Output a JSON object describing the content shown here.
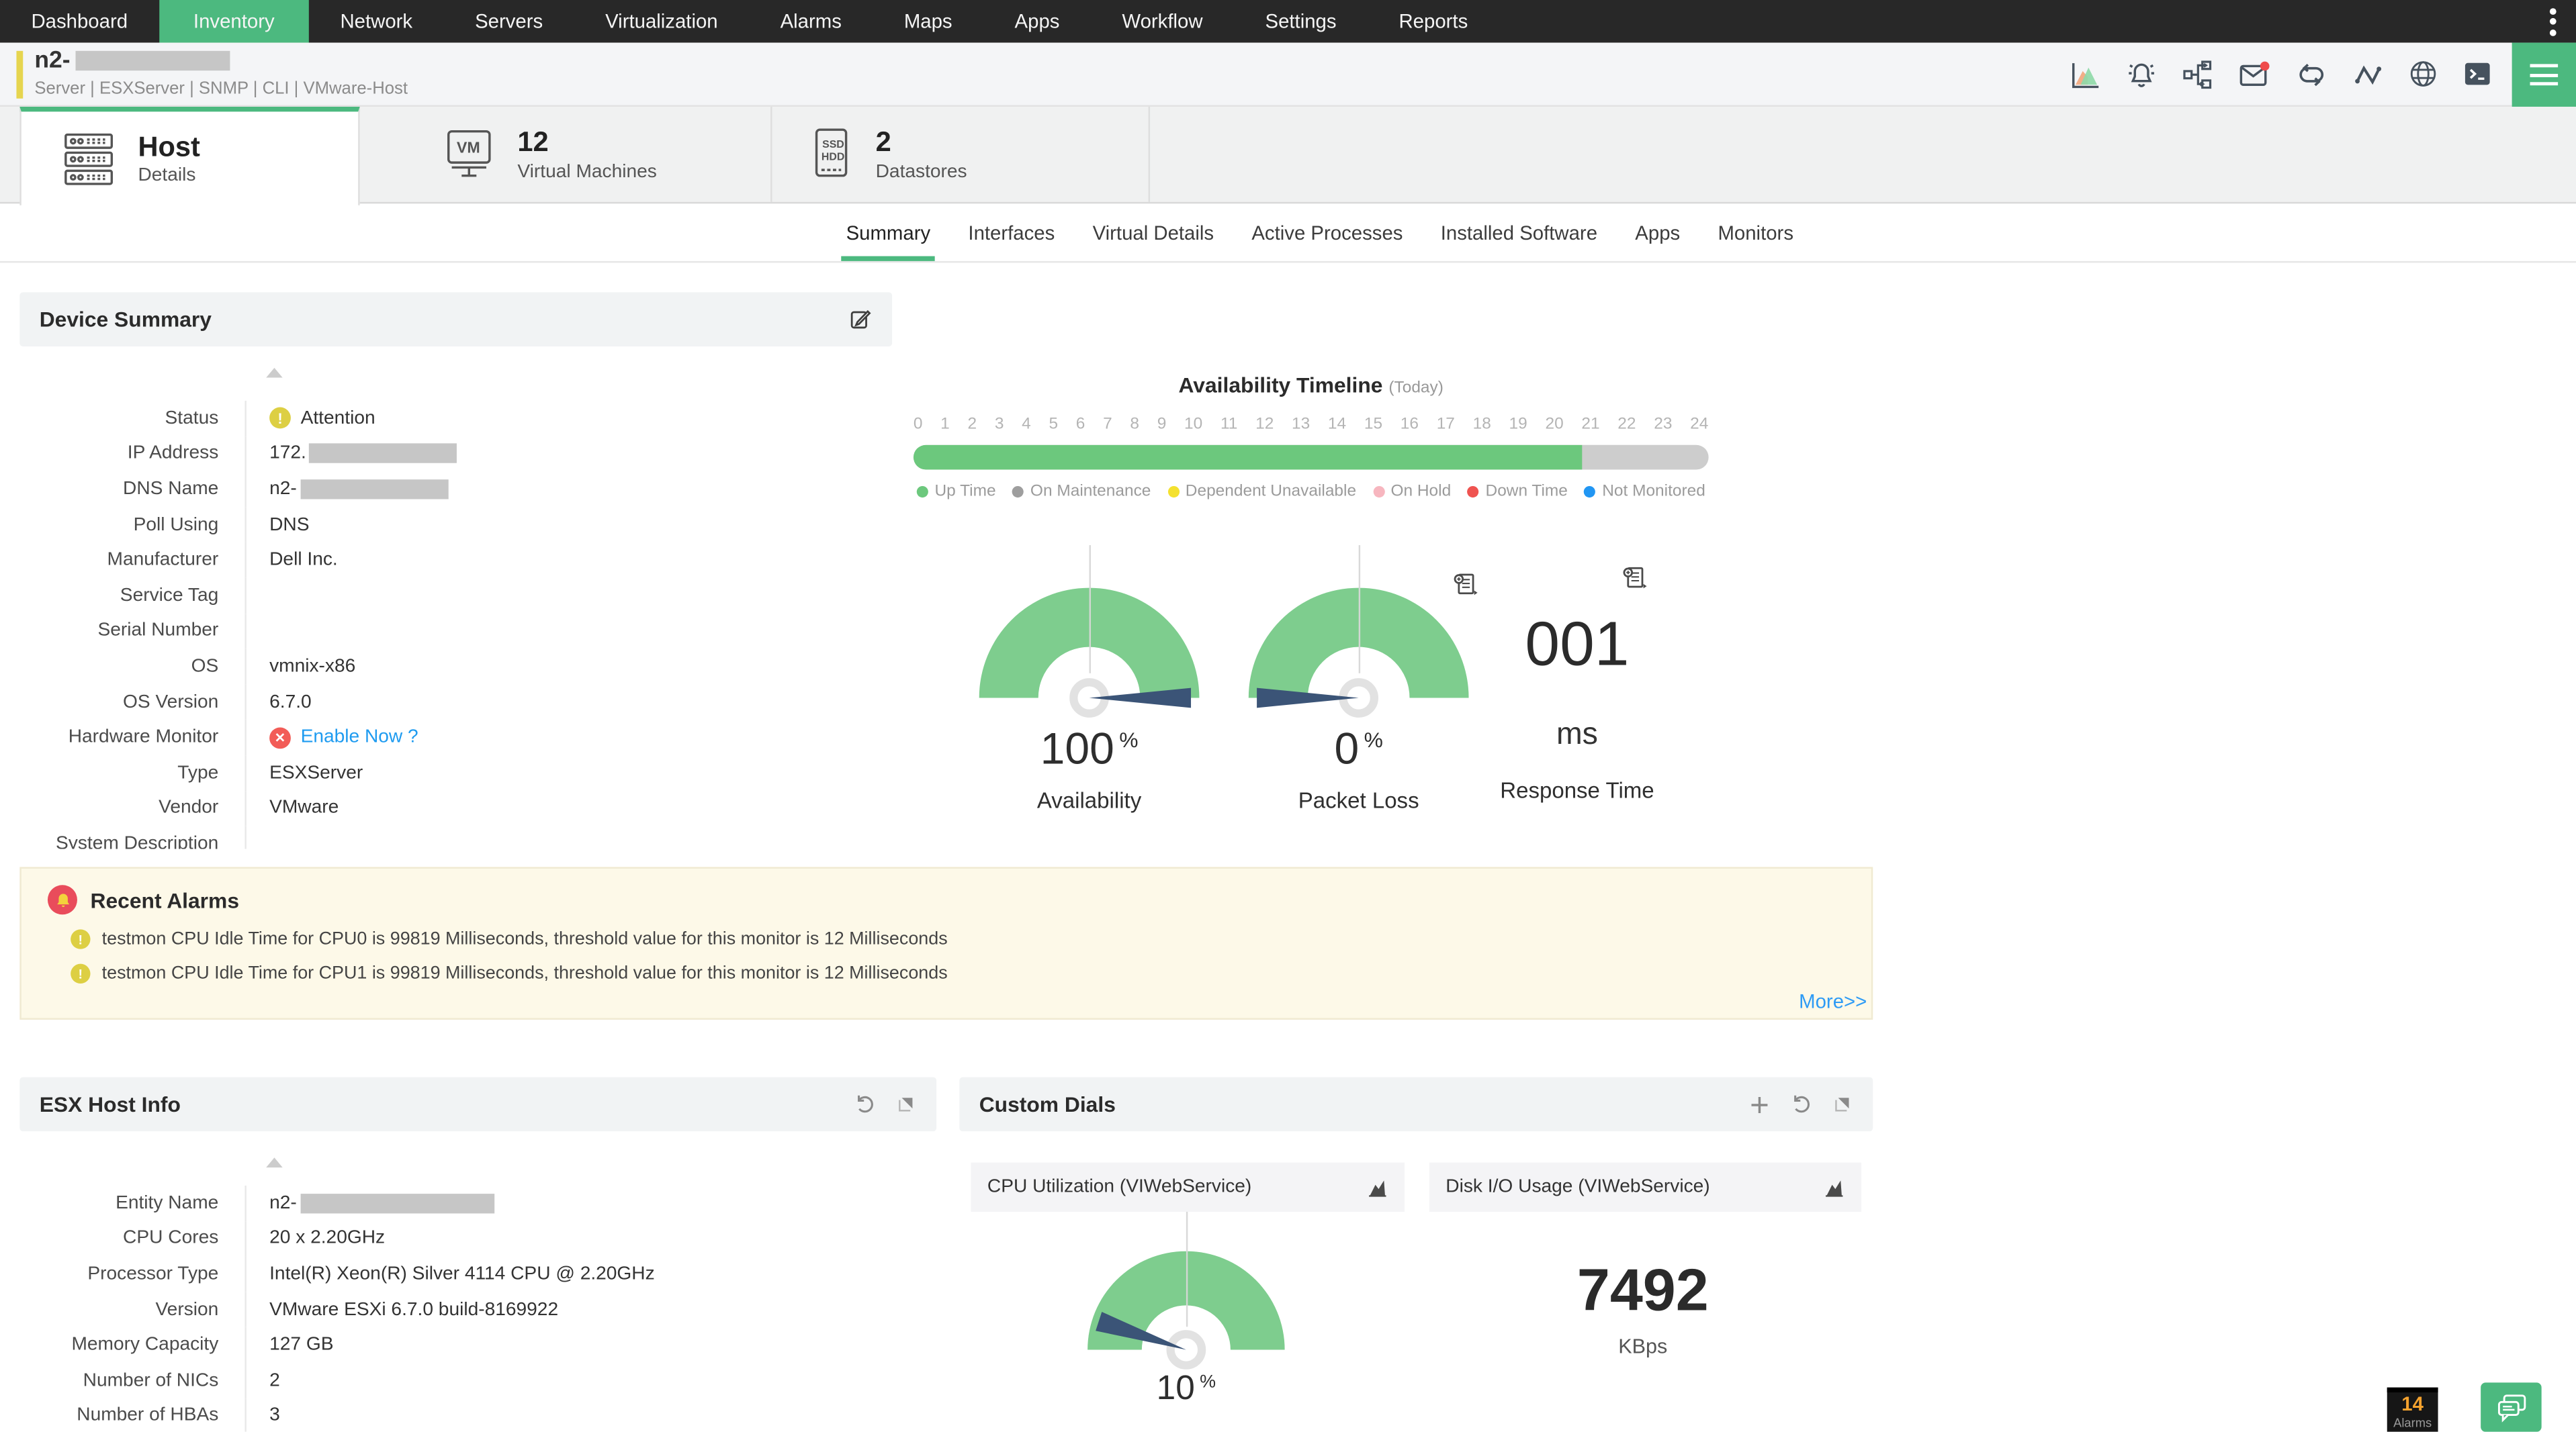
{
  "colors": {
    "accent_green": "#4cb97f",
    "gauge_green": "#7ecd8e",
    "timeline_green": "#6cc87d",
    "needle_navy": "#3b5477",
    "warning_yellow": "#ddcf43",
    "error_red": "#f25c57",
    "link_blue": "#1e9bf0",
    "alarm_panel_bg": "#fdf9e8",
    "nav_bg": "#282828"
  },
  "nav": {
    "items": [
      "Dashboard",
      "Inventory",
      "Network",
      "Servers",
      "Virtualization",
      "Alarms",
      "Maps",
      "Apps",
      "Workflow",
      "Settings",
      "Reports"
    ],
    "active_item": "Inventory"
  },
  "device_header": {
    "name_prefix": "n2-",
    "name_redacted": true,
    "categories": "Server | ESXServer  | SNMP  | CLI  | VMware-Host"
  },
  "tabs": {
    "host": {
      "title": "Host",
      "subtitle": "Details"
    },
    "virtual_machines": {
      "count": "12",
      "label": "Virtual Machines",
      "icon_text": "VM"
    },
    "datastores": {
      "count": "2",
      "label": "Datastores",
      "icon_text_top": "SSD",
      "icon_text_bottom": "HDD"
    }
  },
  "subtabs": {
    "active": "Summary",
    "items": [
      "Summary",
      "Interfaces",
      "Virtual Details",
      "Active Processes",
      "Installed Software",
      "Apps",
      "Monitors"
    ]
  },
  "device_summary": {
    "title": "Device Summary",
    "fields": [
      {
        "label": "Status",
        "value": "Attention",
        "status": "warning"
      },
      {
        "label": "IP Address",
        "value": "172.",
        "redacted": true
      },
      {
        "label": "DNS Name",
        "value": "n2-",
        "redacted": true
      },
      {
        "label": "Poll Using",
        "value": "DNS"
      },
      {
        "label": "Manufacturer",
        "value": "Dell Inc."
      },
      {
        "label": "Service Tag",
        "value": ""
      },
      {
        "label": "Serial Number",
        "value": ""
      },
      {
        "label": "OS",
        "value": "vmnix-x86"
      },
      {
        "label": "OS Version",
        "value": "6.7.0"
      },
      {
        "label": "Hardware Monitor",
        "value": "Enable Now ?",
        "status": "disabled",
        "link": true
      },
      {
        "label": "Type",
        "value": "ESXServer"
      },
      {
        "label": "Vendor",
        "value": "VMware"
      },
      {
        "label": "System Description",
        "value": ""
      }
    ]
  },
  "availability_timeline": {
    "title": "Availability Timeline",
    "period": "(Today)",
    "hours": [
      "0",
      "1",
      "2",
      "3",
      "4",
      "5",
      "6",
      "7",
      "8",
      "9",
      "10",
      "11",
      "12",
      "13",
      "14",
      "15",
      "16",
      "17",
      "18",
      "19",
      "20",
      "21",
      "22",
      "23",
      "24"
    ],
    "up_time_percent": 84,
    "up_width": "84%",
    "legend": [
      {
        "label": "Up Time",
        "color": "#6cc87d"
      },
      {
        "label": "On Maintenance",
        "color": "#9e9e9e"
      },
      {
        "label": "Dependent Unavailable",
        "color": "#f4e12f"
      },
      {
        "label": "On Hold",
        "color": "#f7b6bf"
      },
      {
        "label": "Down Time",
        "color": "#ef5350"
      },
      {
        "label": "Not Monitored",
        "color": "#2196f3"
      }
    ]
  },
  "performance": {
    "availability": {
      "value": "100",
      "unit": "%",
      "label": "Availability",
      "needle_percent": 100
    },
    "packet_loss": {
      "value": "0",
      "unit": "%",
      "label": "Packet Loss",
      "needle_percent": 0
    },
    "response_time": {
      "value": "001",
      "unit": "ms",
      "label": "Response Time"
    }
  },
  "recent_alarms": {
    "title": "Recent Alarms",
    "items": [
      {
        "severity": "attention",
        "text": "testmon CPU Idle Time for CPU0 is 99819 Milliseconds, threshold value for this monitor is 12 Milliseconds"
      },
      {
        "severity": "attention",
        "text": "testmon CPU Idle Time for CPU1 is 99819 Milliseconds, threshold value for this monitor is 12 Milliseconds"
      }
    ],
    "more_label": "More>>"
  },
  "esx_host_info": {
    "title": "ESX Host Info",
    "fields": [
      {
        "label": "Entity Name",
        "value": "n2-",
        "redacted": true
      },
      {
        "label": "CPU Cores",
        "value": "20 x 2.20GHz"
      },
      {
        "label": "Processor Type",
        "value": "Intel(R) Xeon(R) Silver 4114 CPU @ 2.20GHz"
      },
      {
        "label": "Version",
        "value": "VMware ESXi 6.7.0 build-8169922"
      },
      {
        "label": "Memory Capacity",
        "value": "127 GB"
      },
      {
        "label": "Number of NICs",
        "value": "2"
      },
      {
        "label": "Number of HBAs",
        "value": "3"
      }
    ]
  },
  "custom_dials": {
    "title": "Custom Dials",
    "dials": [
      {
        "name": "CPU Utilization (VIWebService)",
        "value": "10",
        "unit": "%",
        "display": "gauge",
        "needle_percent": 10
      },
      {
        "name": "Disk I/O Usage (VIWebService)",
        "value": "7492",
        "unit": "KBps",
        "display": "number"
      }
    ]
  },
  "footer": {
    "alarms_count": "14",
    "alarms_label": "Alarms"
  }
}
